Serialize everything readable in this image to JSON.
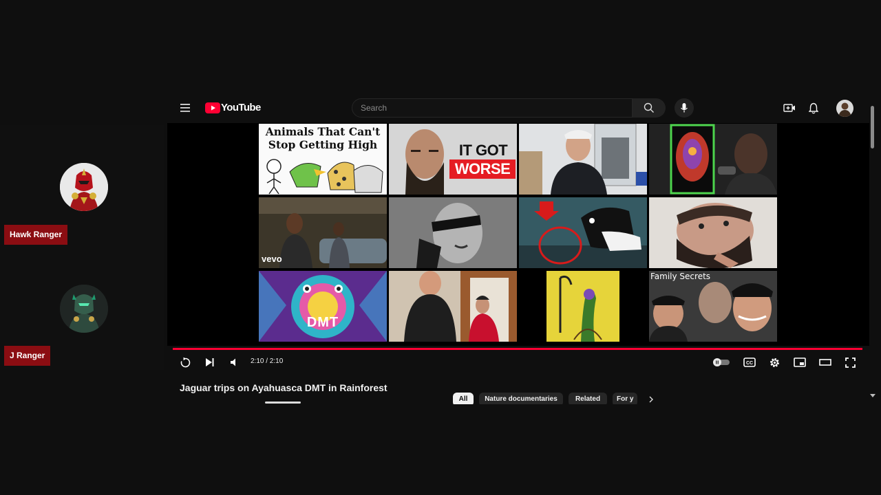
{
  "participants": [
    {
      "name": "Hawk Ranger"
    },
    {
      "name": "J Ranger"
    }
  ],
  "youtube": {
    "logo_text": "YouTube",
    "search_placeholder": "Search",
    "icons": [
      "menu-icon",
      "youtube-logo-icon",
      "search-icon",
      "mic-icon",
      "create-icon",
      "bell-icon",
      "account-avatar"
    ],
    "thumbnails": [
      {
        "text": "Animals That Can't Stop Getting High"
      },
      {
        "text": "IT GOT WORSE"
      },
      {
        "text": ""
      },
      {
        "text": ""
      },
      {
        "text": "vevo"
      },
      {
        "text": ""
      },
      {
        "text": ""
      },
      {
        "text": ""
      },
      {
        "text": "DMT"
      },
      {
        "text": ""
      },
      {
        "text": ""
      },
      {
        "text": "Family Secrets"
      }
    ],
    "player": {
      "time": "2:10 / 2:10",
      "progress": 1.0,
      "accent_color": "#ff0033"
    },
    "video_title": "Jaguar trips on Ayahuasca DMT in Rainforest",
    "chips": [
      "All",
      "Nature documentaries",
      "Related",
      "For y"
    ]
  },
  "colors": {
    "name_tag": "#8b0d12",
    "background": "#0f0f0f"
  }
}
